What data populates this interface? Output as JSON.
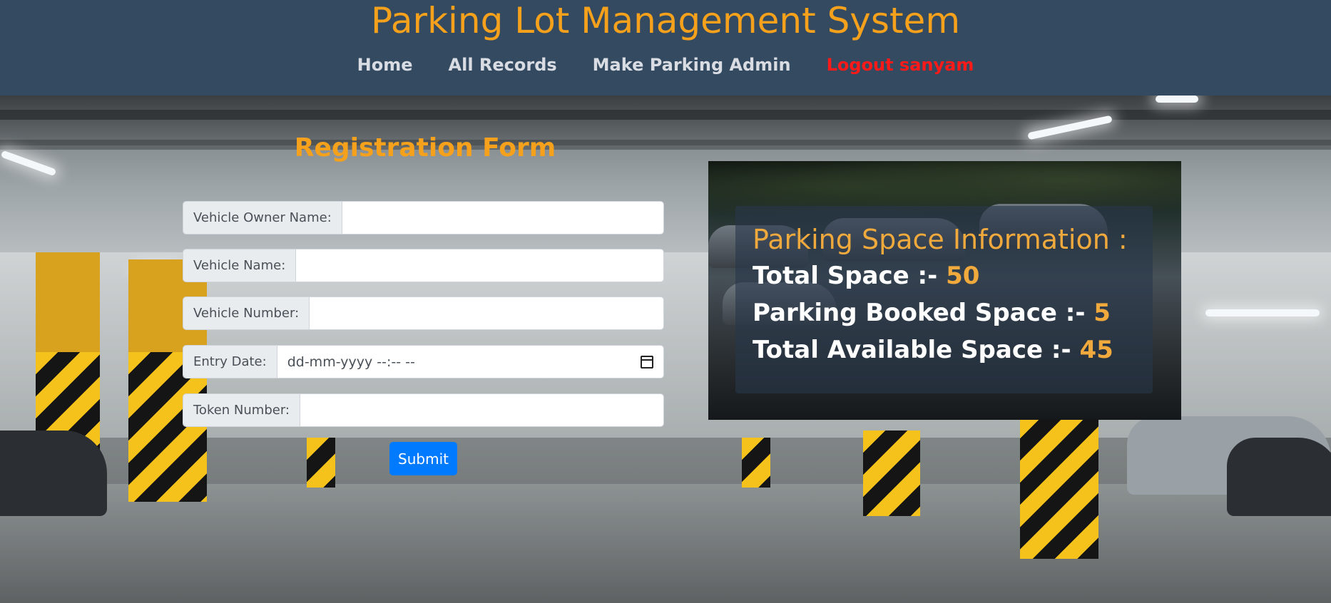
{
  "header": {
    "title": "Parking Lot Management System",
    "nav": [
      {
        "label": "Home"
      },
      {
        "label": "All Records"
      },
      {
        "label": "Make Parking Admin"
      },
      {
        "label": "Logout sanyam"
      }
    ]
  },
  "form": {
    "title": "Registration Form",
    "fields": [
      {
        "label": "Vehicle Owner Name:",
        "value": ""
      },
      {
        "label": "Vehicle Name:",
        "value": ""
      },
      {
        "label": "Vehicle Number:",
        "value": ""
      },
      {
        "label": "Entry Date:",
        "placeholder": "dd-mm-yyyy --:-- --"
      },
      {
        "label": "Token Number:",
        "value": ""
      }
    ],
    "submit_label": "Submit"
  },
  "info": {
    "heading": "Parking Space Information :",
    "total_label": "Total Space :- ",
    "total_value": "50",
    "booked_label": "Parking Booked Space :- ",
    "booked_value": "5",
    "available_label": "Total Available Space :- ",
    "available_value": "45"
  },
  "colors": {
    "accent": "#f5a11c",
    "header_bg": "#344a60",
    "logout": "#ff1a1a",
    "submit": "#007bff"
  },
  "icons": {
    "date_picker": "calendar-icon"
  }
}
